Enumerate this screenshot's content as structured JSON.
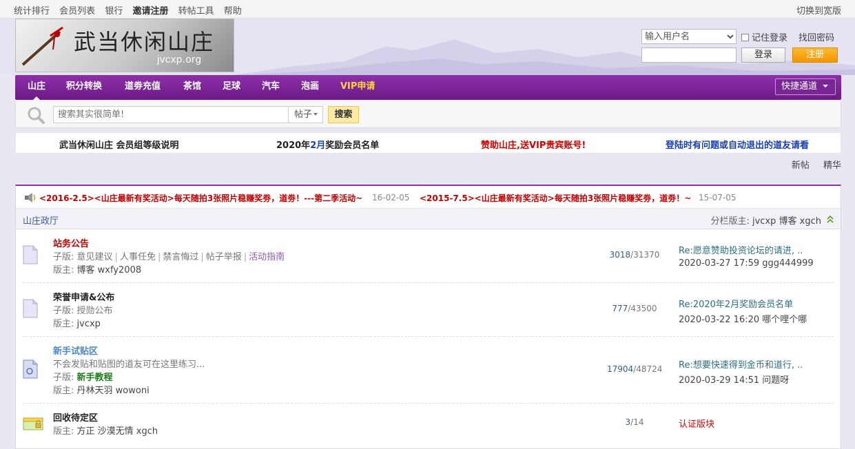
{
  "topbar": {
    "links": [
      "统计排行",
      "会员列表",
      "银行",
      "邀请注册",
      "转帖工具",
      "帮助"
    ],
    "wide_mode": "切换到宽版"
  },
  "logo": {
    "title": "武当休闲山庄",
    "domain": "jvcxp.org"
  },
  "login": {
    "username_placeholder": "输入用户名",
    "remember": "记住登录",
    "forgot": "找回密码",
    "login_btn": "登录",
    "register_btn": "注册"
  },
  "nav": {
    "items": [
      "山庄",
      "积分转换",
      "道劵充值",
      "茶馆",
      "足球",
      "汽车",
      "泡画",
      "VIP申请"
    ],
    "quick": "快捷通道"
  },
  "search": {
    "placeholder": "搜索其实很简单!",
    "type": "帖子",
    "button": "搜索"
  },
  "announcements": [
    {
      "text": "武当休闲山庄 会员组等级说明",
      "color": "#222222"
    },
    {
      "text_pre": "2020年",
      "text_mid": "2月",
      "text_post": "奖励会员名单",
      "color": "#222222",
      "mid_color": "#1a3fb0"
    },
    {
      "text": "赞助山庄,送VIP贵宾账号!",
      "color": "#d40000"
    },
    {
      "text": "登陆时有问题或自动退出的道友请看",
      "color": "#1a3fb0"
    }
  ],
  "post_links": [
    "新帖",
    "精华"
  ],
  "ticker": [
    {
      "text": "<2016-2.5><山庄最新有奖活动>每天随拍3张照片稳赚奖劵，道劵！---第二季活动~",
      "date": "16-02-05"
    },
    {
      "text": "<2015-7.5><山庄最新有奖活动>每天随拍3张照片稳赚奖劵，道劵！~",
      "date": "15-07-05"
    }
  ],
  "category": {
    "name": "山庄政厅",
    "moderators_label": "分栏版主:",
    "moderators": "jvcxp 博客 xgch"
  },
  "forums": [
    {
      "name": "站务公告",
      "name_color": "#c40000",
      "sub_label": "子版:",
      "subs": [
        "意见建议",
        "人事任免",
        "禁言悔过",
        "帖子举报",
        "活动指南"
      ],
      "mod_label": "版主:",
      "mods": "博客 wxfy2008",
      "topics": "3018",
      "posts": "31370",
      "last_title": "Re:愿意赞助投资论坛的请进, ..",
      "last_meta": "2020-03-27 17:59 ggg444999"
    },
    {
      "name": "荣誉申请&公布",
      "name_color": "#222222",
      "sub_label": "子版:",
      "subs": [
        "授勋公布"
      ],
      "mod_label": "版主:",
      "mods": "jvcxp",
      "topics": "777",
      "posts": "43500",
      "last_title": "Re:2020年2月奖励会员名单",
      "last_meta": "2020-03-22 16:20 哪个哩个哪"
    },
    {
      "name": "新手试贴区",
      "name_color": "#4f88c6",
      "desc": "不会发贴和贴图的道友可在这里练习...",
      "sub_label": "子版:",
      "subs": [
        "新手教程"
      ],
      "mod_label": "版主:",
      "mods": "丹林天羽 wowoni",
      "topics": "17904",
      "posts": "48724",
      "last_title": "Re:想要快速得到金币和道行, ..",
      "last_meta": "2020-03-29 14:51 问题呀"
    },
    {
      "name": "回收待定区",
      "name_color": "#222222",
      "mod_label": "版主:",
      "mods": "方正 沙漠无情 xgch",
      "topics": "3",
      "posts": "14",
      "last_title": "认证版块"
    }
  ]
}
